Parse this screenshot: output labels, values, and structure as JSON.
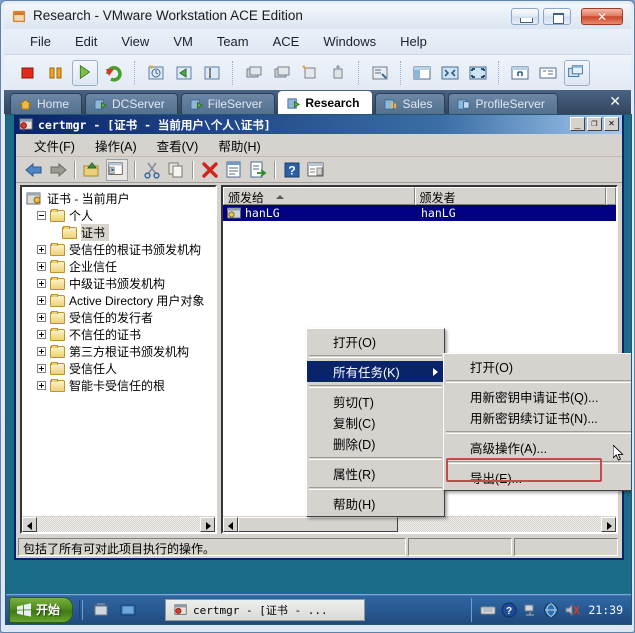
{
  "vmware": {
    "title": "Research - VMware Workstation ACE Edition",
    "title_icon": "vmware-app-icon",
    "window_buttons": {
      "minimize": "minimize-icon",
      "maximize": "maximize-icon",
      "close": "✕"
    },
    "menus": [
      "File",
      "Edit",
      "View",
      "VM",
      "Team",
      "ACE",
      "Windows",
      "Help"
    ],
    "toolbar_groups": [
      [
        "power-off-icon",
        "suspend-icon",
        "power-on-icon",
        "reset-icon"
      ],
      [
        "snapshot-take-icon",
        "snapshot-revert-icon",
        "snapshot-manager-icon"
      ],
      [
        "clone-icon",
        "clone2-icon",
        "teams-icon",
        "usb-icon"
      ],
      [
        "summary-icon"
      ],
      [
        "show-sidebar-icon",
        "fit-guest-icon",
        "fullscreen-icon"
      ],
      [
        "settings-icon",
        "console-view-icon",
        "multiple-windows-icon"
      ]
    ],
    "tabs": [
      {
        "label": "Home",
        "icon": "home-icon",
        "active": false
      },
      {
        "label": "DCServer",
        "icon": "vm-icon",
        "active": false
      },
      {
        "label": "FileServer",
        "icon": "vm-icon",
        "active": false
      },
      {
        "label": "Research",
        "icon": "vm-running-icon",
        "active": true
      },
      {
        "label": "Sales",
        "icon": "vm-icon",
        "active": false
      },
      {
        "label": "ProfileServer",
        "icon": "vm-icon",
        "active": false
      }
    ],
    "tab_close": "✕"
  },
  "certmgr": {
    "title": "certmgr - [证书 - 当前用户\\个人\\证书]",
    "title_icon": "certmgr-icon",
    "window_buttons": {
      "minimize": "_",
      "maximize": "❐",
      "close": "✕"
    },
    "menus": [
      "文件(F)",
      "操作(A)",
      "查看(V)",
      "帮助(H)"
    ],
    "toolbar_icons": [
      "back-icon",
      "forward-icon",
      "up-one-level-icon",
      "show-console-tree-icon",
      "cut-icon",
      "copy-icon",
      "delete-icon",
      "properties-icon",
      "export-icon",
      "help-icon",
      "show-action-pane-icon"
    ],
    "tree": [
      {
        "label": "证书 - 当前用户",
        "indent": 0,
        "expander": "none",
        "icon": "certificates-root-icon",
        "selected": false
      },
      {
        "label": "个人",
        "indent": 1,
        "expander": "minus",
        "icon": "folder-icon",
        "selected": false
      },
      {
        "label": "证书",
        "indent": 2,
        "expander": "none",
        "icon": "folder-icon",
        "selected": true
      },
      {
        "label": "受信任的根证书颁发机构",
        "indent": 1,
        "expander": "plus",
        "icon": "folder-icon",
        "selected": false
      },
      {
        "label": "企业信任",
        "indent": 1,
        "expander": "plus",
        "icon": "folder-icon",
        "selected": false
      },
      {
        "label": "中级证书颁发机构",
        "indent": 1,
        "expander": "plus",
        "icon": "folder-icon",
        "selected": false
      },
      {
        "label": "Active Directory 用户对象",
        "indent": 1,
        "expander": "plus",
        "icon": "folder-icon",
        "selected": false
      },
      {
        "label": "受信任的发行者",
        "indent": 1,
        "expander": "plus",
        "icon": "folder-icon",
        "selected": false
      },
      {
        "label": "不信任的证书",
        "indent": 1,
        "expander": "plus",
        "icon": "folder-icon",
        "selected": false
      },
      {
        "label": "第三方根证书颁发机构",
        "indent": 1,
        "expander": "plus",
        "icon": "folder-icon",
        "selected": false
      },
      {
        "label": "受信任人",
        "indent": 1,
        "expander": "plus",
        "icon": "folder-icon",
        "selected": false
      },
      {
        "label": "智能卡受信任的根",
        "indent": 1,
        "expander": "plus",
        "icon": "folder-icon",
        "selected": false
      }
    ],
    "list": {
      "columns": [
        "颁发给",
        "颁发者"
      ],
      "sort_column": "颁发给",
      "rows": [
        {
          "issued_to": "hanLG",
          "issuer": "hanLG",
          "icon": "certificate-icon",
          "selected": true
        }
      ]
    },
    "status": {
      "main": "包括了所有可对此项目执行的操作。",
      "panel2": "",
      "panel3": ""
    }
  },
  "context_menu": {
    "items": [
      {
        "label": "打开(O)",
        "highlighted": false,
        "submenu": false,
        "separator_after": true
      },
      {
        "label": "所有任务(K)",
        "highlighted": true,
        "submenu": true,
        "separator_after": true
      },
      {
        "label": "剪切(T)",
        "highlighted": false,
        "submenu": false,
        "separator_after": false
      },
      {
        "label": "复制(C)",
        "highlighted": false,
        "submenu": false,
        "separator_after": false
      },
      {
        "label": "删除(D)",
        "highlighted": false,
        "submenu": false,
        "separator_after": true
      },
      {
        "label": "属性(R)",
        "highlighted": false,
        "submenu": false,
        "separator_after": true
      },
      {
        "label": "帮助(H)",
        "highlighted": false,
        "submenu": false,
        "separator_after": false
      }
    ]
  },
  "submenu": {
    "items": [
      {
        "label": "打开(O)",
        "submenu": false,
        "separator_after": true,
        "outlined": false
      },
      {
        "label": "用新密钥申请证书(Q)...",
        "submenu": false,
        "separator_after": false,
        "outlined": false
      },
      {
        "label": "用新密钥续订证书(N)...",
        "submenu": false,
        "separator_after": true,
        "outlined": false
      },
      {
        "label": "高级操作(A)...",
        "submenu": true,
        "separator_after": true,
        "outlined": false
      },
      {
        "label": "导出(E)...",
        "submenu": false,
        "separator_after": false,
        "outlined": true
      }
    ],
    "highlight_color": "#c24b4b"
  },
  "taskbar": {
    "start_label": "开始",
    "start_icon": "windows-start-icon",
    "quick_launch": [
      "quick-launch-icon",
      "show-desktop-icon"
    ],
    "task_buttons": [
      {
        "label": "certmgr - [证书 - ...",
        "icon": "certmgr-icon",
        "active": true
      }
    ],
    "tray_icons": [
      "keyboard-layout-icon",
      "help-icon",
      "network-icon",
      "vmware-tray-icon",
      "volume-muted-icon"
    ],
    "clock": "21:39"
  },
  "colors": {
    "vm_tab_active_bg": "#ffffff",
    "vm_titlebar": "#e6edf6",
    "mmc_titlebar": "#0a246a",
    "selection": "#000080",
    "menu_highlight": "#0a246a",
    "desktop": "#1a6c88",
    "taskbar": "#2a5a93",
    "export_outline": "#c24b4b",
    "dialog_face": "#d6d3ce"
  }
}
